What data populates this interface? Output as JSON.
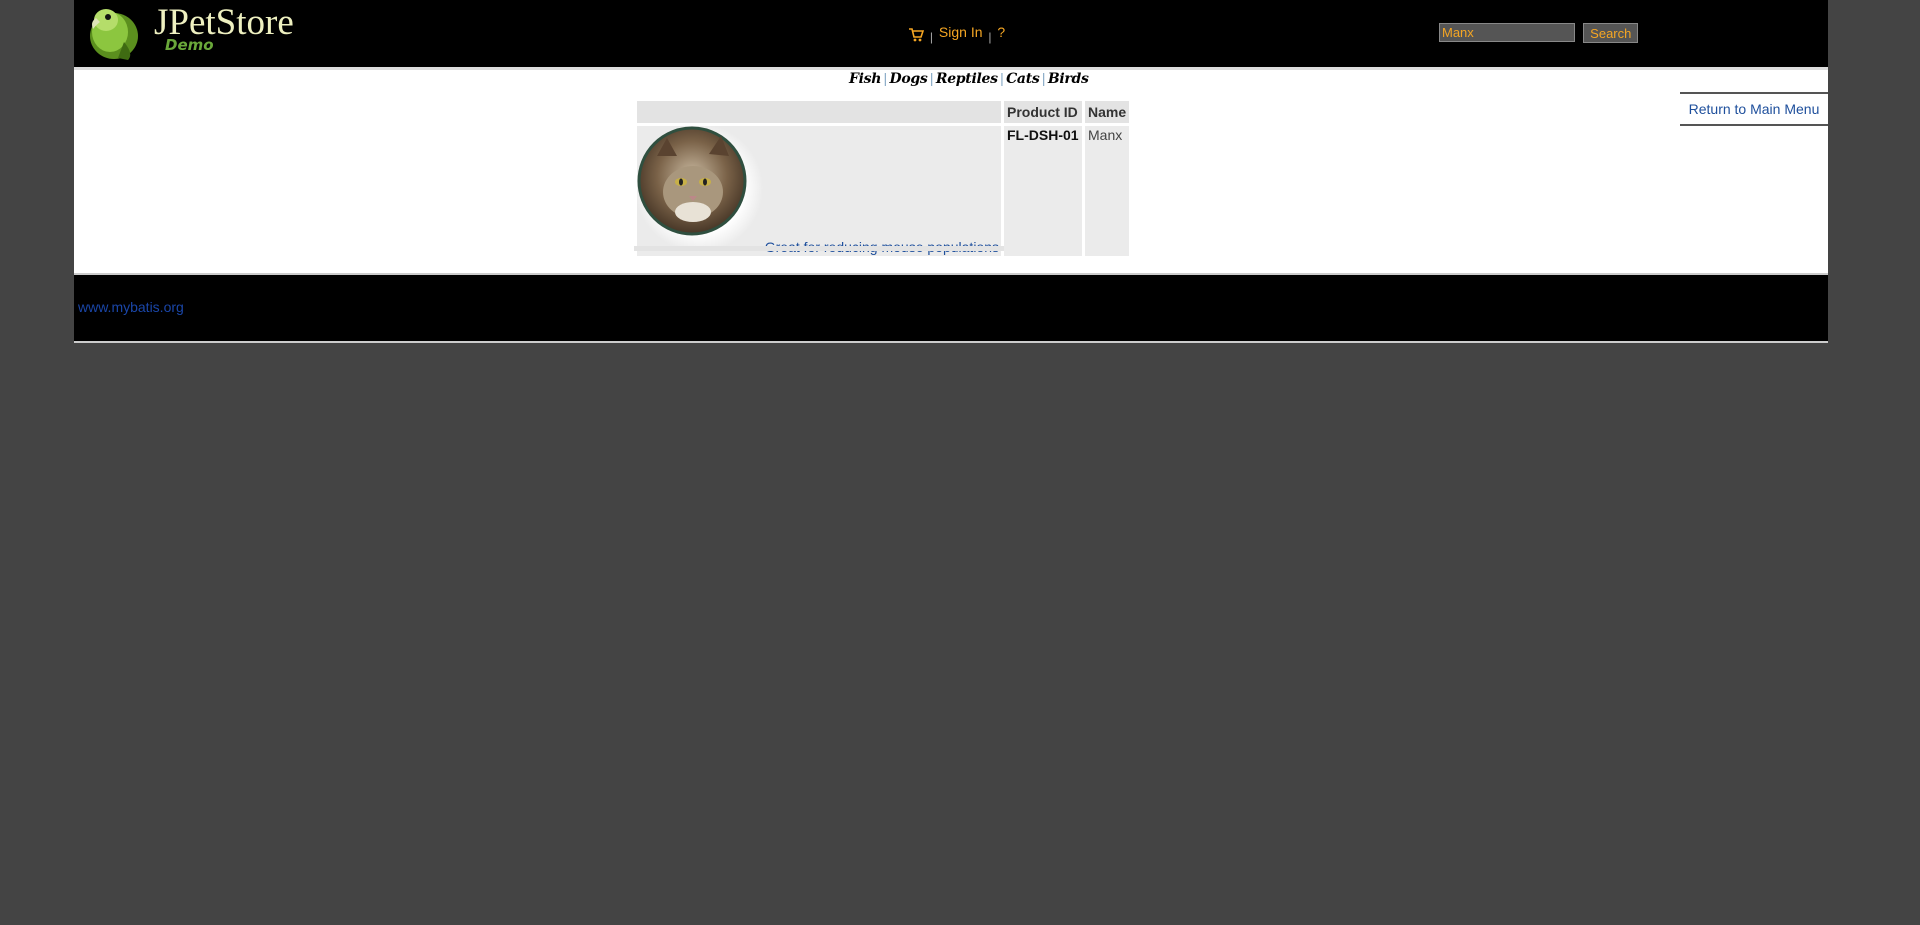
{
  "header": {
    "logo_title": "JPetStore",
    "logo_subtitle": "Demo",
    "menu": {
      "separator": "|",
      "sign_in_label": "Sign In",
      "help_label": "?"
    },
    "search": {
      "value": "Manx",
      "button_label": "Search"
    }
  },
  "quicklinks": {
    "items": [
      "Fish",
      "Dogs",
      "Reptiles",
      "Cats",
      "Birds"
    ],
    "separator": "|"
  },
  "back_link": "Return to Main Menu",
  "product_table": {
    "headers": [
      "",
      "Product ID",
      "Name"
    ],
    "rows": [
      {
        "image_icon": "cat-photo",
        "description": "Great for reducing mouse populations",
        "product_id": "FL-DSH-01",
        "name": "Manx"
      }
    ]
  },
  "footer": {
    "link": "www.mybatis.org"
  },
  "colors": {
    "background": "#444444",
    "header": "#000000",
    "menu_link": "#f5a623",
    "content_link": "#1e4f9c"
  }
}
